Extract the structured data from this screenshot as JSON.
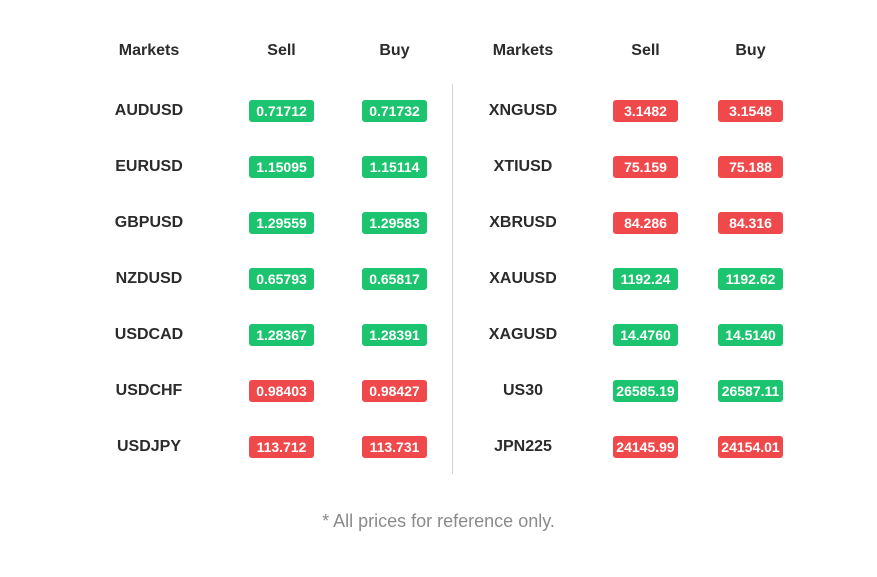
{
  "headers": {
    "markets": "Markets",
    "sell": "Sell",
    "buy": "Buy"
  },
  "colors": {
    "up": "#1cc470",
    "down": "#f0494c"
  },
  "left": [
    {
      "market": "AUDUSD",
      "sell": "0.71712",
      "buy": "0.71732",
      "trend": "up"
    },
    {
      "market": "EURUSD",
      "sell": "1.15095",
      "buy": "1.15114",
      "trend": "up"
    },
    {
      "market": "GBPUSD",
      "sell": "1.29559",
      "buy": "1.29583",
      "trend": "up"
    },
    {
      "market": "NZDUSD",
      "sell": "0.65793",
      "buy": "0.65817",
      "trend": "up"
    },
    {
      "market": "USDCAD",
      "sell": "1.28367",
      "buy": "1.28391",
      "trend": "up"
    },
    {
      "market": "USDCHF",
      "sell": "0.98403",
      "buy": "0.98427",
      "trend": "down"
    },
    {
      "market": "USDJPY",
      "sell": "113.712",
      "buy": "113.731",
      "trend": "down"
    }
  ],
  "right": [
    {
      "market": "XNGUSD",
      "sell": "3.1482",
      "buy": "3.1548",
      "trend": "down"
    },
    {
      "market": "XTIUSD",
      "sell": "75.159",
      "buy": "75.188",
      "trend": "down"
    },
    {
      "market": "XBRUSD",
      "sell": "84.286",
      "buy": "84.316",
      "trend": "down"
    },
    {
      "market": "XAUUSD",
      "sell": "1192.24",
      "buy": "1192.62",
      "trend": "up"
    },
    {
      "market": "XAGUSD",
      "sell": "14.4760",
      "buy": "14.5140",
      "trend": "up"
    },
    {
      "market": "US30",
      "sell": "26585.19",
      "buy": "26587.11",
      "trend": "up"
    },
    {
      "market": "JPN225",
      "sell": "24145.99",
      "buy": "24154.01",
      "trend": "down"
    }
  ],
  "footnote": "* All prices for reference only."
}
